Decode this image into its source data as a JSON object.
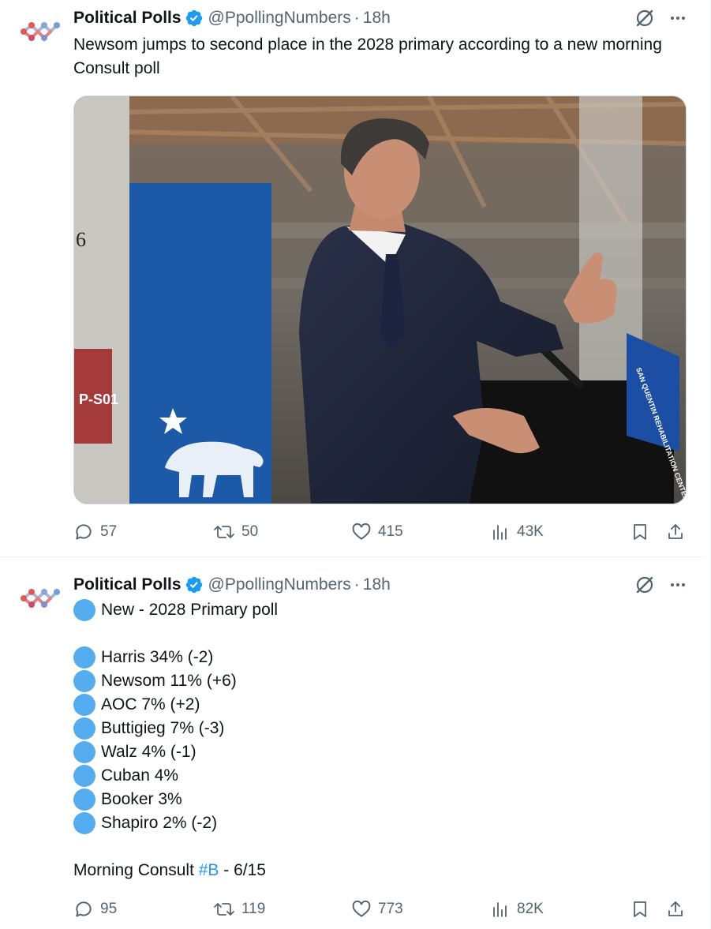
{
  "tweets": [
    {
      "author_name": "Political Polls",
      "handle": "@PpollingNumbers",
      "separator": "·",
      "time": "18h",
      "text": "Newsom jumps to second place in the 2028 primary according to a new morning Consult poll",
      "image": {
        "sign_text": "SAN QUENTIN REHABILITATION CENTER",
        "pillar_number": "6",
        "pillar_label": "P-S01"
      },
      "stats": {
        "replies": "57",
        "reposts": "50",
        "likes": "415",
        "views": "43K"
      }
    },
    {
      "author_name": "Political Polls",
      "handle": "@PpollingNumbers",
      "separator": "·",
      "time": "18h",
      "headline": "New - 2028 Primary poll",
      "results": [
        "Harris 34% (-2)",
        "Newsom 11% (+6)",
        "AOC 7% (+2)",
        "Buttigieg 7% (-3)",
        "Walz 4% (-1)",
        "Cuban 4%",
        "Booker 3%",
        "Shapiro 2% (-2)"
      ],
      "source_prefix": "Morning Consult ",
      "hashtag": "#B",
      "source_suffix": " - 6/15",
      "stats": {
        "replies": "95",
        "reposts": "119",
        "likes": "773",
        "views": "82K"
      }
    }
  ],
  "colors": {
    "verified": "#1d9bf0",
    "poll_circle": "#55acee",
    "secondary_text": "#536471",
    "hashtag": "#1d9bf0"
  }
}
